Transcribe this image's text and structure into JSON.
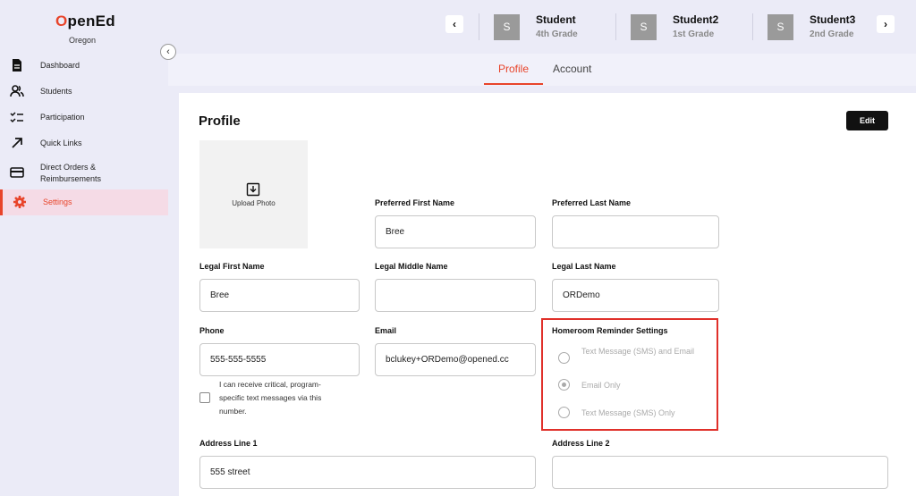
{
  "brand": {
    "logo_prefix": "O",
    "logo_rest": "penEd",
    "region": "Oregon"
  },
  "sidebar": {
    "items": [
      {
        "label": "Dashboard",
        "icon": "document-icon"
      },
      {
        "label": "Students",
        "icon": "users-icon"
      },
      {
        "label": "Participation",
        "icon": "checklist-icon"
      },
      {
        "label": "Quick Links",
        "icon": "arrow-up-right-icon"
      },
      {
        "label": "Direct Orders & Reimbursements",
        "icon": "credit-card-icon"
      },
      {
        "label": "Settings",
        "icon": "gear-icon",
        "active": true
      }
    ]
  },
  "students": [
    {
      "initial": "S",
      "name": "Student",
      "grade": "4th Grade"
    },
    {
      "initial": "S",
      "name": "Student2",
      "grade": "1st Grade"
    },
    {
      "initial": "S",
      "name": "Student3",
      "grade": "2nd Grade"
    }
  ],
  "tabs": [
    {
      "label": "Profile",
      "active": true
    },
    {
      "label": "Account",
      "active": false
    }
  ],
  "profile": {
    "title": "Profile",
    "edit_label": "Edit",
    "upload_label": "Upload Photo",
    "fields": {
      "preferred_first": {
        "label": "Preferred First Name",
        "value": "Bree"
      },
      "preferred_last": {
        "label": "Preferred Last Name",
        "value": ""
      },
      "legal_first": {
        "label": "Legal First Name",
        "value": "Bree"
      },
      "legal_middle": {
        "label": "Legal Middle Name",
        "value": ""
      },
      "legal_last": {
        "label": "Legal Last Name",
        "value": "ORDemo"
      },
      "phone": {
        "label": "Phone",
        "value": "555-555-5555"
      },
      "email": {
        "label": "Email",
        "value": "bclukey+ORDemo@opened.cc"
      },
      "address1": {
        "label": "Address Line 1",
        "value": "555 street"
      },
      "address2": {
        "label": "Address Line 2",
        "value": ""
      }
    },
    "sms_consent": "I can receive critical, program-specific text messages via this number.",
    "homeroom": {
      "label": "Homeroom Reminder Settings",
      "options": [
        {
          "label": "Text Message (SMS) and Email",
          "selected": false
        },
        {
          "label": "Email Only",
          "selected": true
        },
        {
          "label": "Text Message (SMS) Only",
          "selected": false
        }
      ]
    }
  },
  "colors": {
    "accent": "#e8442a",
    "highlight": "#e0302a",
    "sidebar_bg": "#ebebf7"
  }
}
